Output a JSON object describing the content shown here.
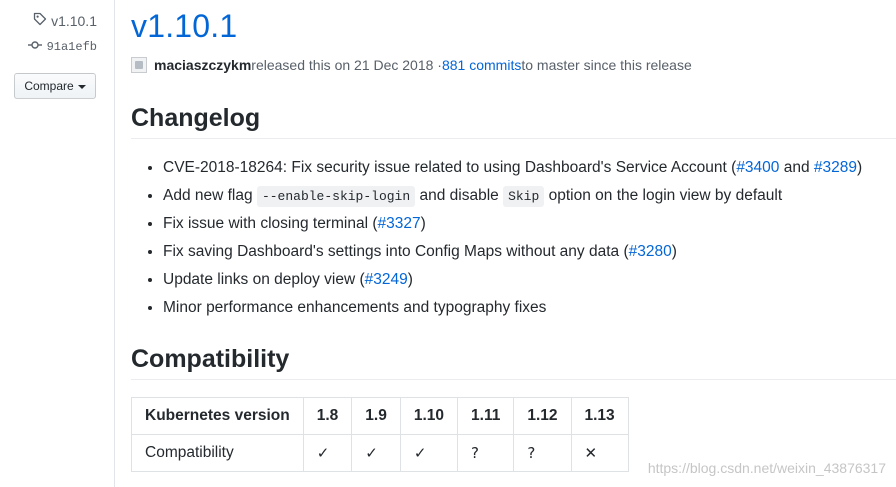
{
  "sidebar": {
    "tag": "v1.10.1",
    "commit": "91a1efb",
    "compare_label": "Compare"
  },
  "release": {
    "title": "v1.10.1",
    "author": "maciaszczykm",
    "released_text": " released this on 21 Dec 2018 · ",
    "commits_link": "881 commits",
    "since_text": " to master since this release"
  },
  "changelog": {
    "heading": "Changelog",
    "items": [
      {
        "pre": "CVE-2018-18264: Fix security issue related to using Dashboard's Service Account (",
        "link1": "#3400",
        "mid": " and ",
        "link2": "#3289",
        "post": ")"
      },
      {
        "pre": "Add new flag ",
        "code1": "--enable-skip-login",
        "mid": " and disable ",
        "code2": "Skip",
        "post": " option on the login view by default"
      },
      {
        "pre": "Fix issue with closing terminal (",
        "link": "#3327",
        "post": ")"
      },
      {
        "pre": "Fix saving Dashboard's settings into Config Maps without any data (",
        "link": "#3280",
        "post": ")"
      },
      {
        "pre": "Update links on deploy view (",
        "link": "#3249",
        "post": ")"
      },
      {
        "text": "Minor performance enhancements and typography fixes"
      }
    ]
  },
  "compatibility": {
    "heading": "Compatibility",
    "headers": [
      "Kubernetes version",
      "1.8",
      "1.9",
      "1.10",
      "1.11",
      "1.12",
      "1.13"
    ],
    "row": [
      "Compatibility",
      "✓",
      "✓",
      "✓",
      "?",
      "?",
      "✕"
    ]
  },
  "watermark": "https://blog.csdn.net/weixin_43876317"
}
